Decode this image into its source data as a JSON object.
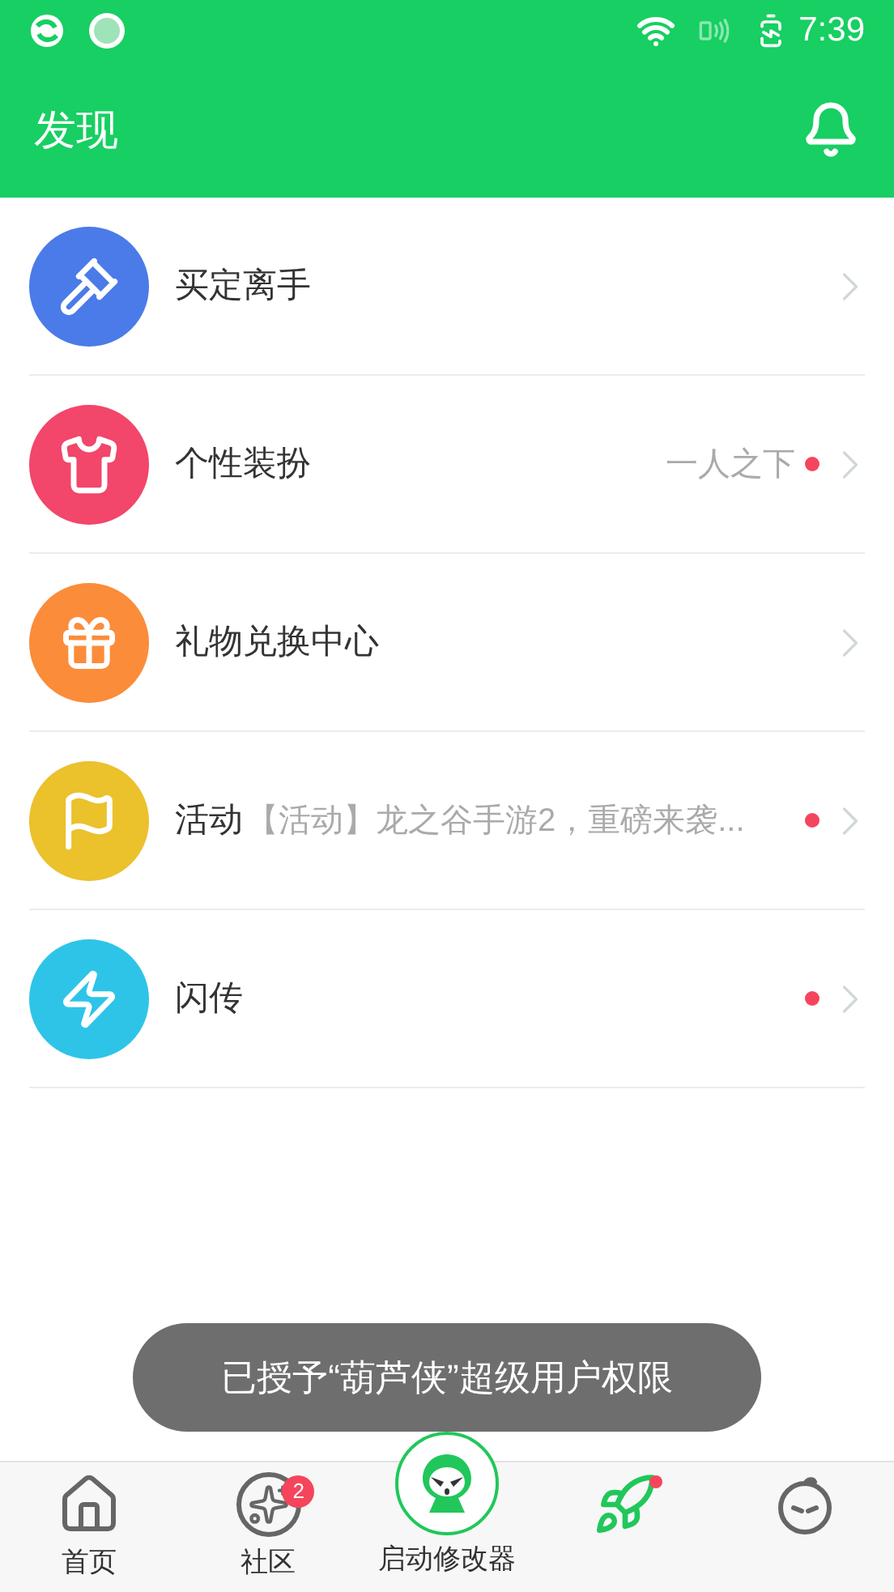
{
  "status_bar": {
    "time": "7:39"
  },
  "header": {
    "title": "发现"
  },
  "items": [
    {
      "title": "买定离手",
      "kind": "gavel",
      "color": "#4a7be8",
      "dot": false
    },
    {
      "title": "个性装扮",
      "subtitle": "一人之下",
      "kind": "shirt",
      "color": "#f2466a",
      "dot": true
    },
    {
      "title": "礼物兑换中心",
      "kind": "gift",
      "color": "#fb8c3a",
      "dot": false
    },
    {
      "title": "活动",
      "subtitle": "【活动】龙之谷手游2，重磅来袭...",
      "kind": "flag",
      "color": "#ebc12c",
      "dot": true
    },
    {
      "title": "闪传",
      "kind": "zap",
      "color": "#2ec4e8",
      "dot": true
    }
  ],
  "toast": "已授予“葫芦侠”超级用户权限",
  "bottom_nav": [
    {
      "kind": "home",
      "label": "首页",
      "dot": false
    },
    {
      "kind": "community",
      "label": "社区",
      "badge": "2",
      "dot": false
    },
    {
      "kind": "center",
      "label": "启动修改器",
      "dot": false
    },
    {
      "kind": "rocket",
      "dot": true
    },
    {
      "kind": "face",
      "dot": false
    }
  ]
}
